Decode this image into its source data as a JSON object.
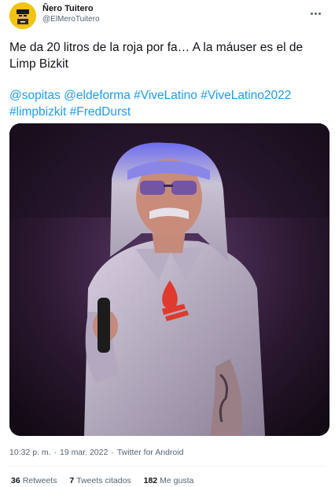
{
  "author": {
    "display_name": "Ñero Tuitero",
    "handle": "@ElMeroTuitero"
  },
  "tweet": {
    "text_line_1": "Me da 20 litros de la roja por fa… A la máuser es el de",
    "text_line_2": "Limp Bizkit",
    "hashtags_line_1": [
      "@sopitas",
      "@eldeforma",
      "#ViveLatino",
      "#ViveLatino2022"
    ],
    "hashtags_line_2": [
      "#limpbizkit",
      "#FredDurst"
    ]
  },
  "meta": {
    "time": "10:32 p. m.",
    "date": "19 mar. 2022",
    "separator": "·",
    "source": "Twitter for Android"
  },
  "stats": {
    "retweets_count": "36",
    "retweets_label": "Retweets",
    "quotes_count": "7",
    "quotes_label": "Tweets citados",
    "likes_count": "182",
    "likes_label": "Me gusta"
  },
  "colors": {
    "link": "#1d9bf0",
    "text": "#0f1419",
    "secondary": "#536471",
    "avatar_bg": "#f1c40f"
  }
}
